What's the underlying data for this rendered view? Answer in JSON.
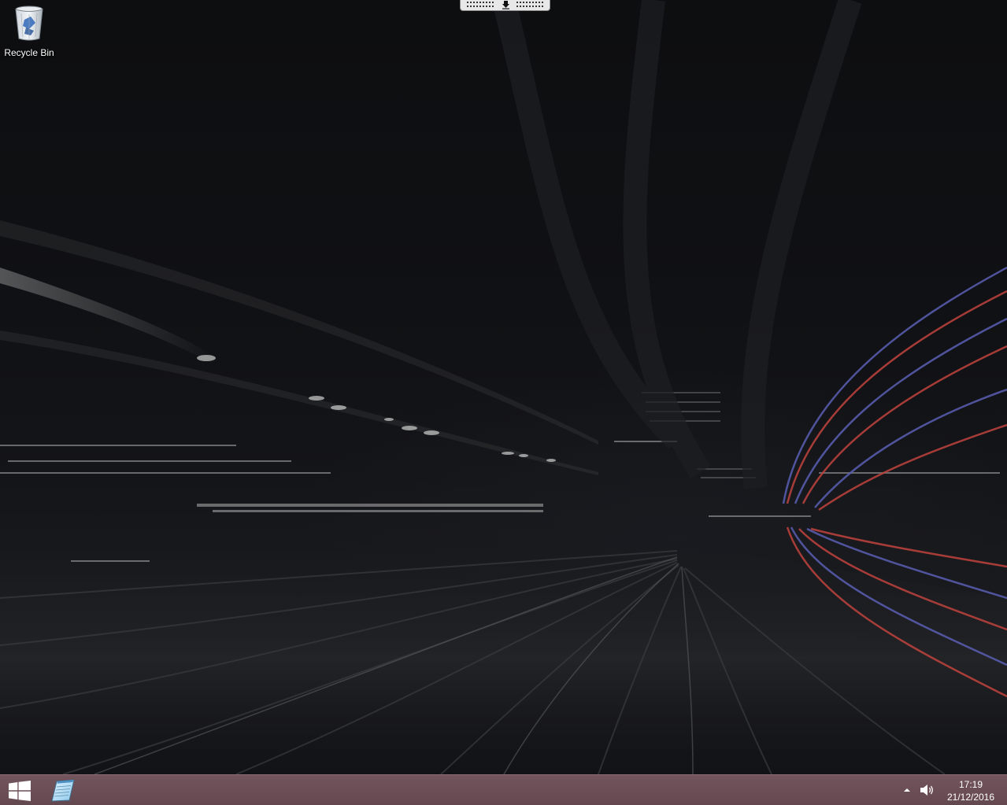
{
  "desktop": {
    "icons": [
      {
        "label": "Recycle Bin",
        "icon": "recycle-bin-icon"
      }
    ]
  },
  "remote_bar": {
    "icon": "pin-icon"
  },
  "taskbar": {
    "start_icon": "windows-logo-icon",
    "pinned": [
      {
        "icon": "notepad-icon"
      }
    ],
    "tray": {
      "chevron_icon": "chevron-up-icon",
      "volume_icon": "speaker-icon"
    },
    "clock": {
      "time": "17:19",
      "date": "21/12/2016"
    },
    "colors": {
      "taskbar": "#74545c",
      "accent": "#ffffff"
    }
  }
}
